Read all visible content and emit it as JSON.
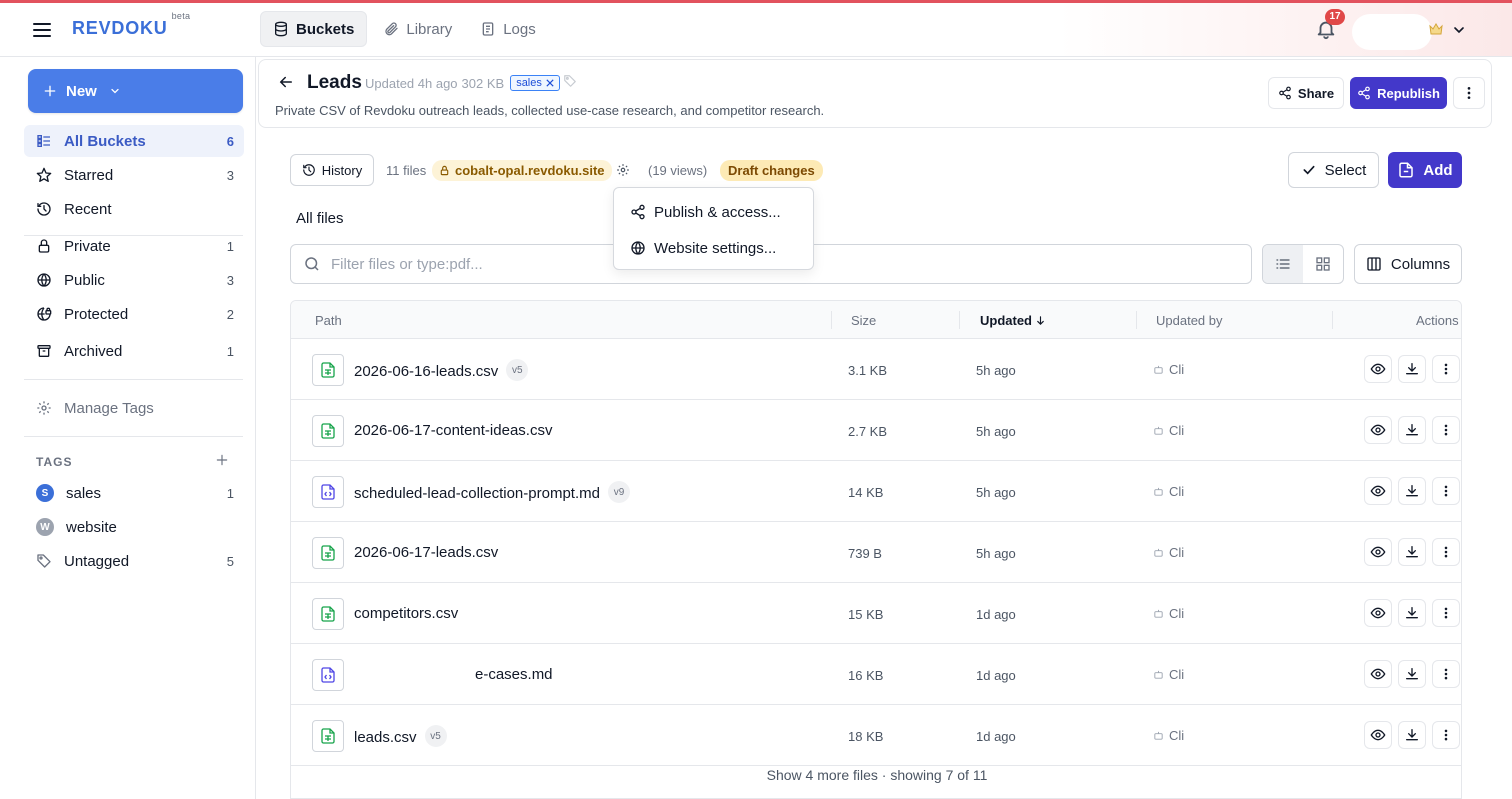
{
  "app": {
    "brand": "REVDOKU",
    "brand_sup": "beta",
    "notifications": "17"
  },
  "nav": {
    "tabs": [
      {
        "label": "Buckets"
      },
      {
        "label": "Library"
      },
      {
        "label": "Logs"
      }
    ]
  },
  "sidebar": {
    "new_label": "New",
    "items": [
      {
        "label": "All Buckets",
        "count": "6"
      },
      {
        "label": "Starred",
        "count": "3"
      },
      {
        "label": "Recent",
        "count": ""
      },
      {
        "label": "Private",
        "count": "1"
      },
      {
        "label": "Public",
        "count": "3"
      },
      {
        "label": "Protected",
        "count": "2"
      },
      {
        "label": "Archived",
        "count": "1"
      }
    ],
    "manage_tags": "Manage Tags",
    "tags_header": "TAGS",
    "tags": [
      {
        "initial": "S",
        "label": "sales",
        "count": "1",
        "color": "#3b6fd8"
      },
      {
        "initial": "W",
        "label": "website",
        "count": "",
        "color": "#9ca3af"
      },
      {
        "label": "Untagged",
        "count": "5"
      }
    ]
  },
  "bucket": {
    "title": "Leads",
    "updated": "Updated 4h ago",
    "size": "302 KB",
    "tag": "sales",
    "description": "Private CSV of Revdoku outreach leads, collected use-case research, and competitor research.",
    "share": "Share",
    "republish": "Republish"
  },
  "toolbar": {
    "history": "History",
    "file_count": "11 files",
    "domain": "cobalt-opal.revdoku.site",
    "views": "(19 views)",
    "draft": "Draft changes",
    "select": "Select",
    "add": "Add",
    "all_files": "All files",
    "columns": "Columns"
  },
  "search": {
    "placeholder": "Filter files or type:pdf..."
  },
  "dropdown": {
    "items": [
      "Publish & access...",
      "Website settings..."
    ]
  },
  "table": {
    "headers": {
      "path": "Path",
      "size": "Size",
      "updated": "Updated",
      "updated_by": "Updated by",
      "actions": "Actions"
    },
    "rows": [
      {
        "name": "2026-06-16-leads.csv",
        "version": "v5",
        "size": "3.1 KB",
        "updated": "5h ago",
        "by": "Cli",
        "kind": "csv"
      },
      {
        "name": "2026-06-17-content-ideas.csv",
        "version": "",
        "size": "2.7 KB",
        "updated": "5h ago",
        "by": "Cli",
        "kind": "csv"
      },
      {
        "name": "scheduled-lead-collection-prompt.md",
        "version": "v9",
        "size": "14 KB",
        "updated": "5h ago",
        "by": "Cli",
        "kind": "md"
      },
      {
        "name": "2026-06-17-leads.csv",
        "version": "",
        "size": "739 B",
        "updated": "5h ago",
        "by": "Cli",
        "kind": "csv"
      },
      {
        "name": "competitors.csv",
        "version": "",
        "size": "15 KB",
        "updated": "1d ago",
        "by": "Cli",
        "kind": "csv"
      },
      {
        "name": "e-cases.md",
        "version": "",
        "size": "16 KB",
        "updated": "1d ago",
        "by": "Cli",
        "kind": "md"
      },
      {
        "name": "leads.csv",
        "version": "v5",
        "size": "18 KB",
        "updated": "1d ago",
        "by": "Cli",
        "kind": "csv"
      }
    ],
    "footer": "Show 4 more files · showing 7 of 11"
  },
  "colors": {
    "accent": "#4338ca",
    "brand": "#3b6fd8",
    "stripe": "#e2525e",
    "csv_icon": "#16a34a",
    "md_icon": "#4f46e5"
  }
}
